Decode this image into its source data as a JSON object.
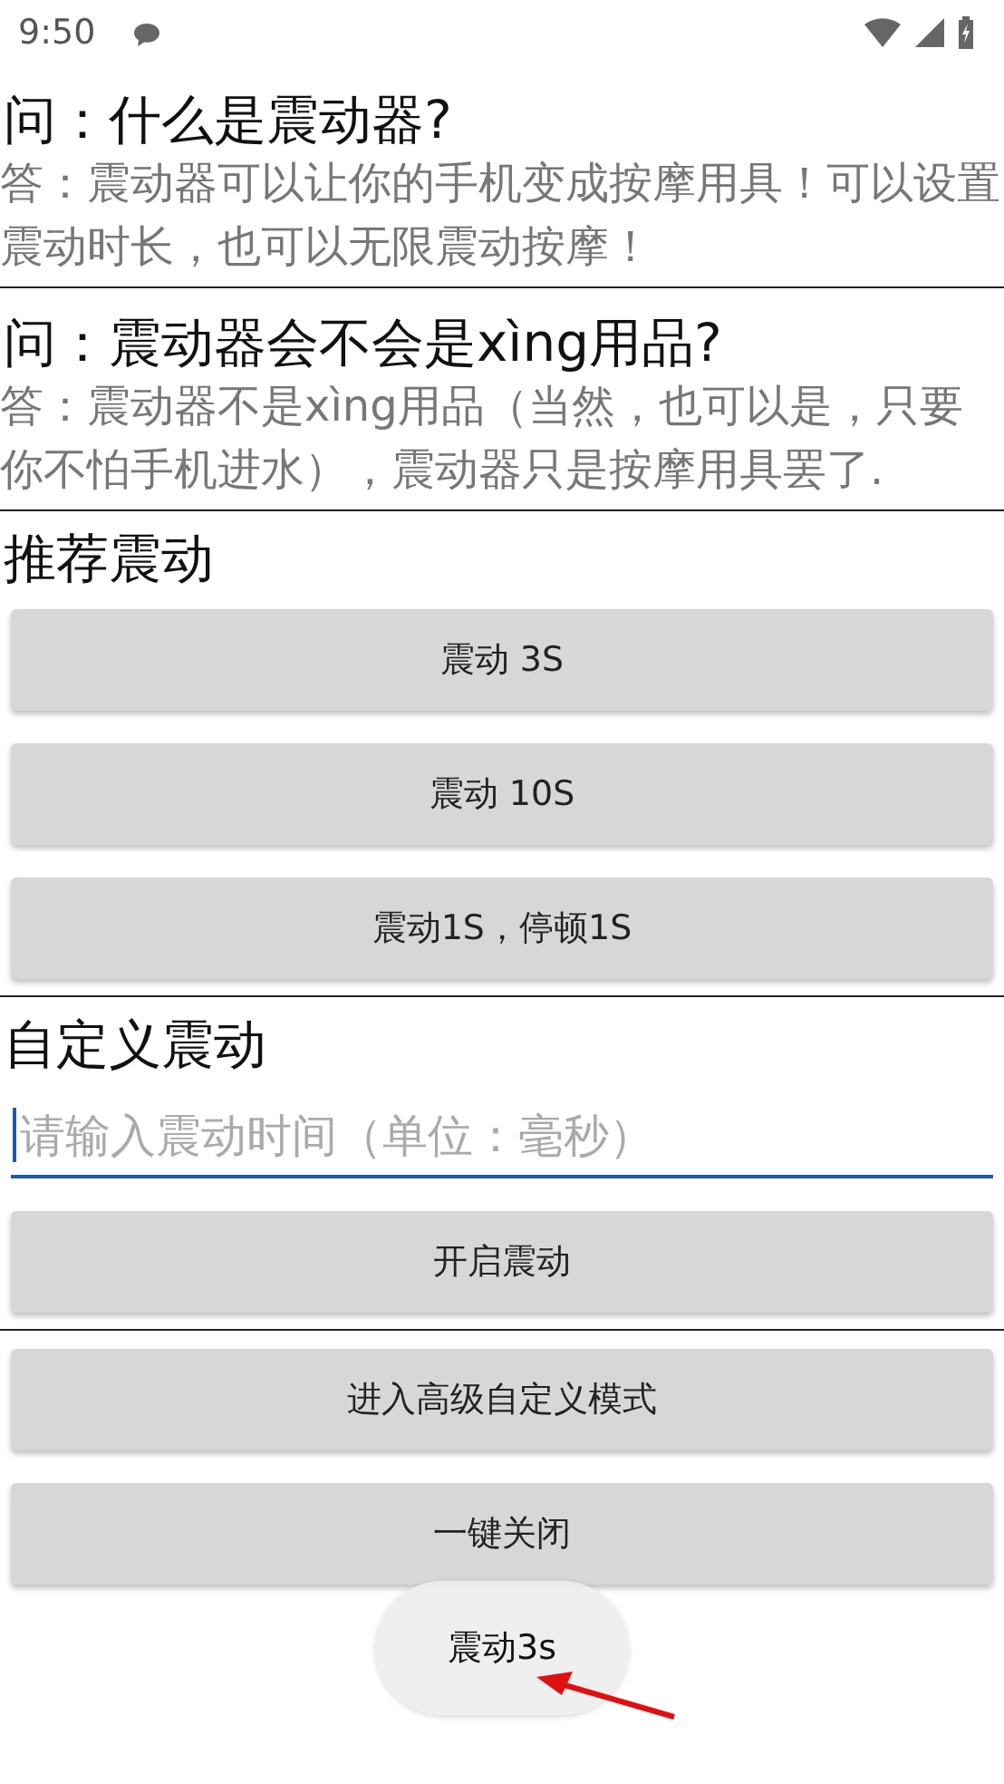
{
  "status_bar": {
    "time": "9:50"
  },
  "faq": [
    {
      "question": "问：什么是震动器?",
      "answer": "答：震动器可以让你的手机变成按摩用具！可以设置震动时长，也可以无限震动按摩！"
    },
    {
      "question": "问：震动器会不会是xìng用品?",
      "answer": "答：震动器不是xìng用品（当然，也可以是，只要你不怕手机进水），震动器只是按摩用具罢了."
    }
  ],
  "recommended": {
    "heading": "推荐震动",
    "buttons": [
      "震动 3S",
      "震动 10S",
      "震动1S，停顿1S"
    ]
  },
  "custom": {
    "heading": "自定义震动",
    "input": {
      "placeholder": "请输入震动时间（单位：毫秒）"
    },
    "start_button": "开启震动"
  },
  "more_buttons": [
    "进入高级自定义模式",
    "一键关闭"
  ],
  "toast": {
    "text": "震动3s"
  }
}
